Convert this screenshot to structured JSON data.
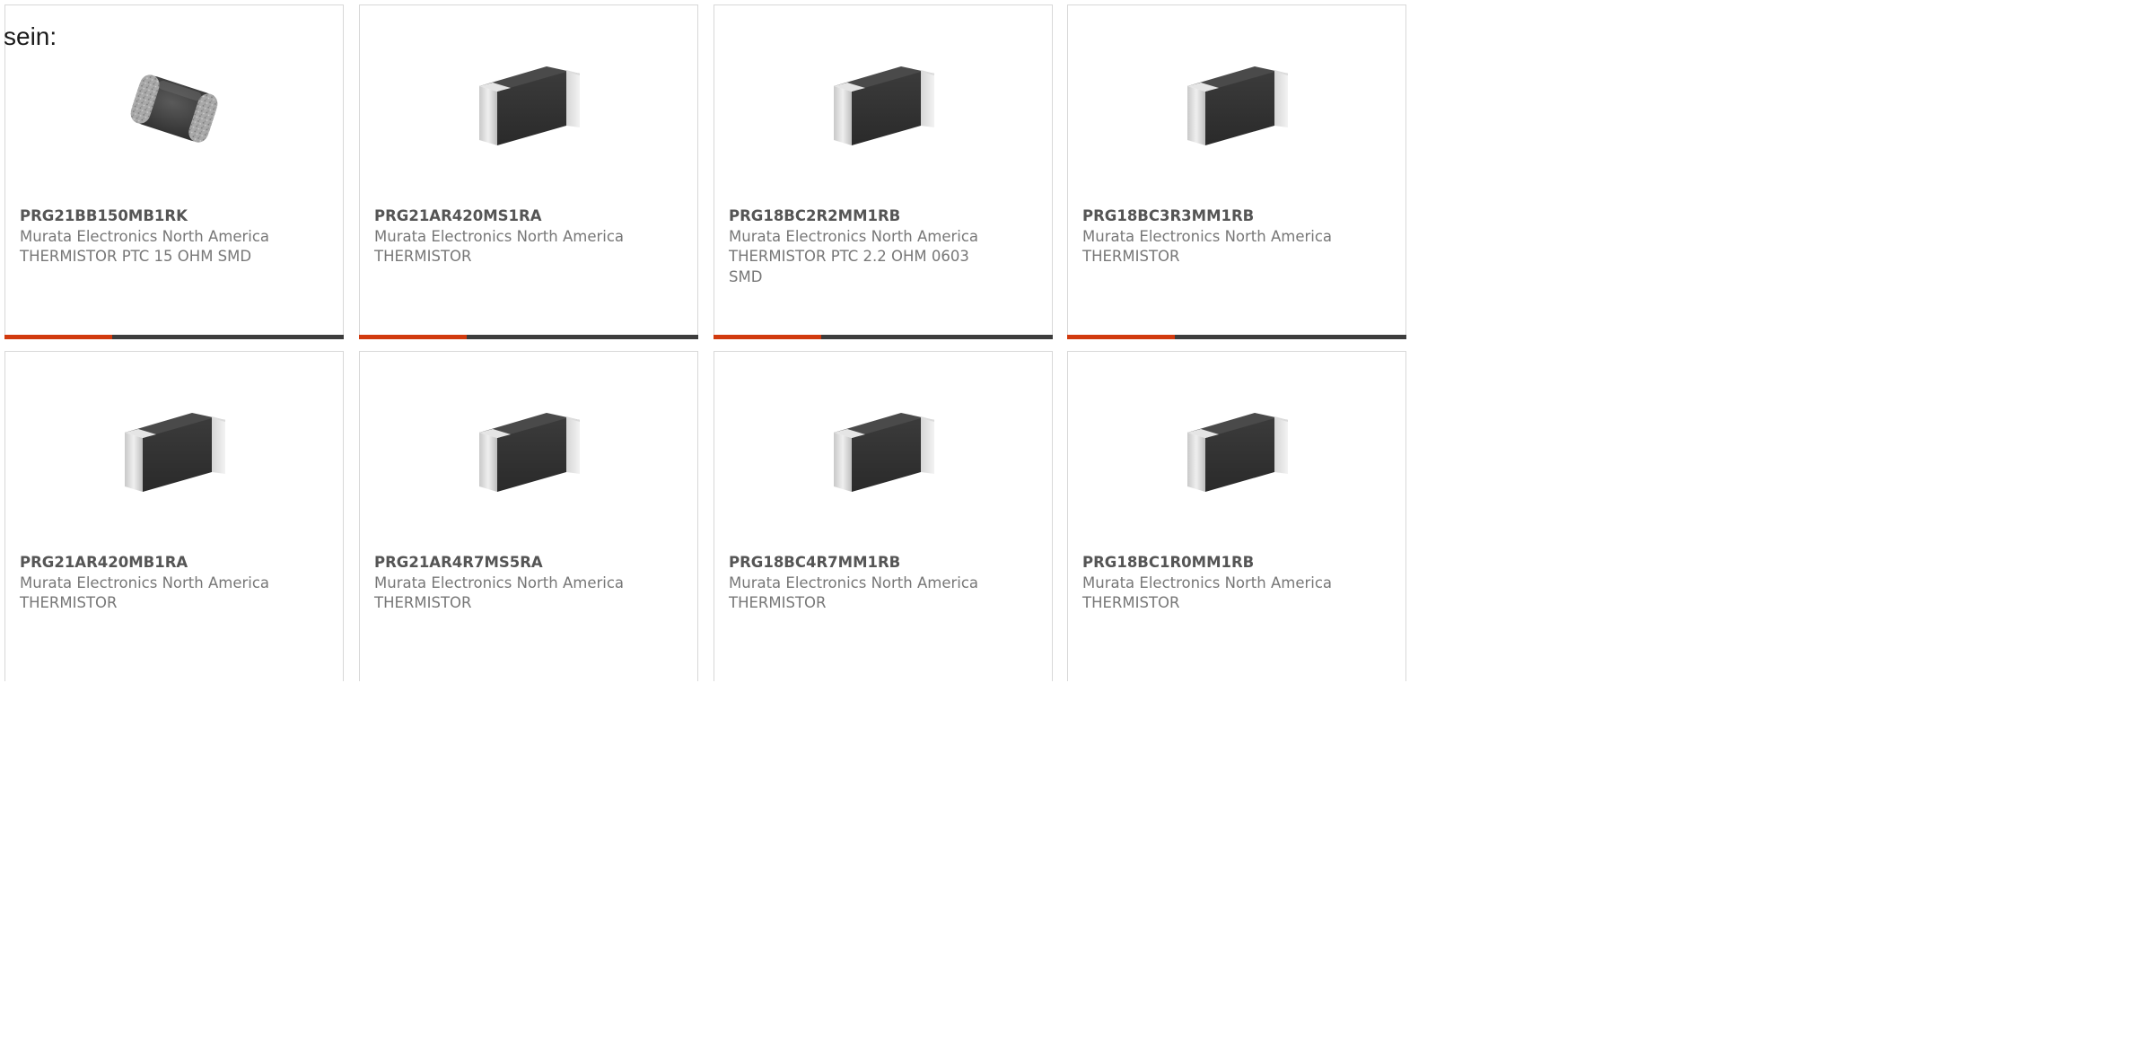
{
  "intro_text": "sein:",
  "colors": {
    "accent": "#d13a0e",
    "bar": "#3d3d3d",
    "border": "#d8d8d8",
    "part_number": "#555555",
    "secondary_text": "#777777"
  },
  "products": [
    {
      "part_number": "PRG21BB150MB1RK",
      "manufacturer": "Murata Electronics North America",
      "description": "THERMISTOR PTC 15 OHM SMD",
      "image": "rounded-chip-thermistor-icon"
    },
    {
      "part_number": "PRG21AR420MS1RA",
      "manufacturer": "Murata Electronics North America",
      "description": "THERMISTOR",
      "image": "chip-thermistor-icon"
    },
    {
      "part_number": "PRG18BC2R2MM1RB",
      "manufacturer": "Murata Electronics North America",
      "description": "THERMISTOR PTC 2.2 OHM 0603 SMD",
      "image": "chip-thermistor-icon"
    },
    {
      "part_number": "PRG18BC3R3MM1RB",
      "manufacturer": "Murata Electronics North America",
      "description": "THERMISTOR",
      "image": "chip-thermistor-icon"
    },
    {
      "part_number": "PRG21AR420MB1RA",
      "manufacturer": "Murata Electronics North America",
      "description": "THERMISTOR",
      "image": "chip-thermistor-icon"
    },
    {
      "part_number": "PRG21AR4R7MS5RA",
      "manufacturer": "Murata Electronics North America",
      "description": "THERMISTOR",
      "image": "chip-thermistor-icon"
    },
    {
      "part_number": "PRG18BC4R7MM1RB",
      "manufacturer": "Murata Electronics North America",
      "description": "THERMISTOR",
      "image": "chip-thermistor-icon"
    },
    {
      "part_number": "PRG18BC1R0MM1RB",
      "manufacturer": "Murata Electronics North America",
      "description": "THERMISTOR",
      "image": "chip-thermistor-icon"
    }
  ]
}
